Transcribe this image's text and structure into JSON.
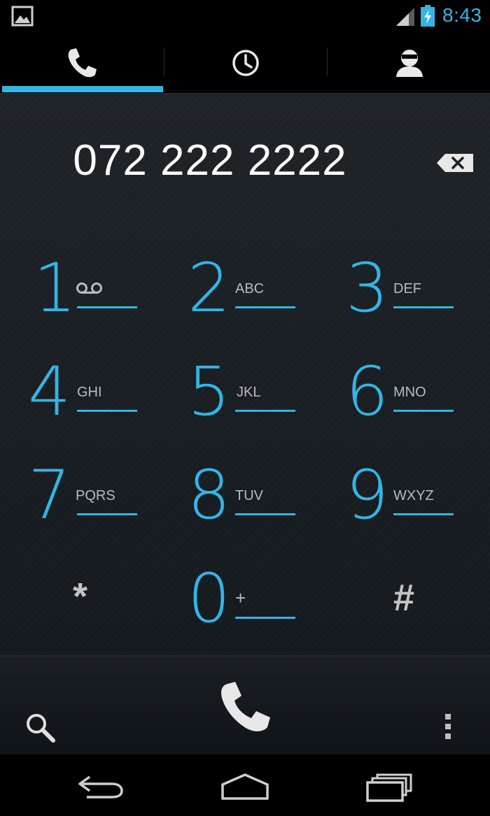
{
  "status_bar": {
    "time": "8:43",
    "icons": [
      "gallery-icon",
      "signal-icon",
      "battery-charging-icon"
    ],
    "accent_color": "#33b5e5"
  },
  "tabs": [
    {
      "id": "phone",
      "icon": "phone-icon",
      "selected": true
    },
    {
      "id": "recents",
      "icon": "clock-icon",
      "selected": false
    },
    {
      "id": "contacts",
      "icon": "person-icon",
      "selected": false
    }
  ],
  "dialer": {
    "number": "072 222 2222",
    "backspace_icon": "backspace-icon"
  },
  "keypad": [
    {
      "digit": "1",
      "letters": "",
      "sub_icon": "voicemail-icon"
    },
    {
      "digit": "2",
      "letters": "ABC"
    },
    {
      "digit": "3",
      "letters": "DEF"
    },
    {
      "digit": "4",
      "letters": "GHI"
    },
    {
      "digit": "5",
      "letters": "JKL"
    },
    {
      "digit": "6",
      "letters": "MNO"
    },
    {
      "digit": "7",
      "letters": "PQRS"
    },
    {
      "digit": "8",
      "letters": "TUV"
    },
    {
      "digit": "9",
      "letters": "WXYZ"
    },
    {
      "digit": "*",
      "letters": ""
    },
    {
      "digit": "0",
      "letters": "+"
    },
    {
      "digit": "#",
      "letters": ""
    }
  ],
  "actions": {
    "search_icon": "search-icon",
    "call_icon": "call-icon",
    "menu_icon": "overflow-menu-icon"
  },
  "nav": {
    "back_icon": "back-icon",
    "home_icon": "home-icon",
    "recents_icon": "recent-apps-icon"
  }
}
